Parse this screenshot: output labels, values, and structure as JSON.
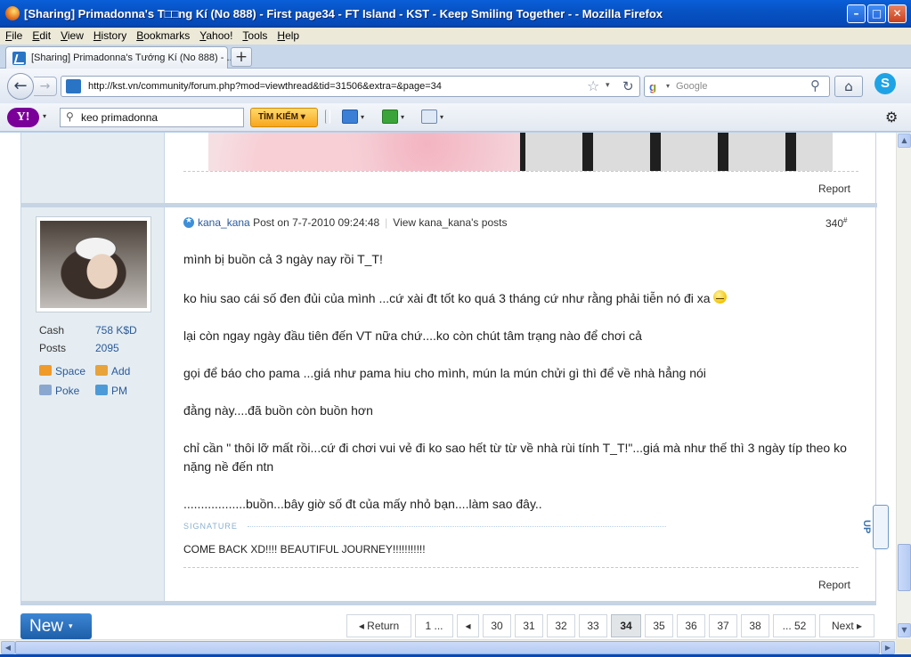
{
  "window": {
    "title": "[Sharing] Primadonna's T□□ng Kí (No 888) - First page34 - FT Island - KST - Keep Smiling Together - - Mozilla Firefox",
    "minimize": "–",
    "maximize": "□",
    "close": "✕"
  },
  "menu": [
    "File",
    "Edit",
    "View",
    "History",
    "Bookmarks",
    "Yahoo!",
    "Tools",
    "Help"
  ],
  "tab": {
    "label": "[Sharing] Primadonna's Tướng Kí (No 888) - ...",
    "new_tab": "+"
  },
  "nav": {
    "back": "←",
    "forward": "→",
    "url": "http://kst.vn/community/forum.php?mod=viewthread&tid=31506&extra=&page=34",
    "star": "☆",
    "dropdown": "▾",
    "reload": "↻",
    "search_engine": "g",
    "search_placeholder": "Google",
    "search_icon": "⚲",
    "home": "⌂",
    "skype": "S"
  },
  "yahoo_toolbar": {
    "logo": "Y!",
    "dropdown": "▾",
    "search_value": "keo primadonna",
    "search_icon": "⚲",
    "search_button": "TÌM KIẾM",
    "search_button_arrow": "▾",
    "settings_icon": "⚙"
  },
  "previous_post": {
    "report": "Report"
  },
  "post": {
    "author": "kana_kana",
    "posted_on": "Post on 7-7-2010 09:24:48",
    "view_posts": "View kana_kana's posts",
    "divider": "|",
    "number": "340",
    "number_suffix": "#",
    "stats": [
      {
        "label": "Cash",
        "value": "758 K$D"
      },
      {
        "label": "Posts",
        "value": "2095"
      }
    ],
    "user_links": [
      "Space",
      "Add",
      "Poke",
      "PM"
    ],
    "lines": [
      "mình bị buồn cả 3 ngày nay rồi T_T!",
      "ko hiu sao cái số đen đủi của mình ...cứ xài đt tốt ko quá 3 tháng cứ như rằng phải tiễn nó đi xa",
      "lại còn ngay ngày đầu tiên đến VT nữa chứ....ko còn chút tâm trạng nào để chơi cả",
      "gọi để báo cho pama ...giá như pama hiu cho mình, mún la mún chửi gì thì để về nhà hẳng nói",
      "đằng này....đã buồn còn buồn hơn",
      "chỉ cần \" thôi lỡ mất rồi...cứ đi chơi vui vẻ đi ko sao hết từ từ về nhà rùi tính T_T!\"...giá mà như thế thì 3 ngày típ theo ko",
      "nặng nề đến ntn",
      "..................buồn...bây giờ số đt của mấy nhỏ bạn....làm sao đây.."
    ],
    "signature_label": "SIGNATURE",
    "signature": "COME BACK XD!!!! BEAUTIFUL JOURNEY!!!!!!!!!!!",
    "report": "Report",
    "up": "UP"
  },
  "bottom": {
    "new_button": "New",
    "new_arrow": "▾",
    "pages": {
      "return": "◂ Return",
      "first": "1 ...",
      "prev": "◂",
      "p30": "30",
      "p31": "31",
      "p32": "32",
      "p33": "33",
      "p34": "34",
      "p35": "35",
      "p36": "36",
      "p37": "37",
      "p38": "38",
      "last": "... 52",
      "next": "Next ▸"
    }
  },
  "scroll": {
    "up": "▲",
    "down": "▼",
    "left": "◀",
    "right": "▶"
  }
}
